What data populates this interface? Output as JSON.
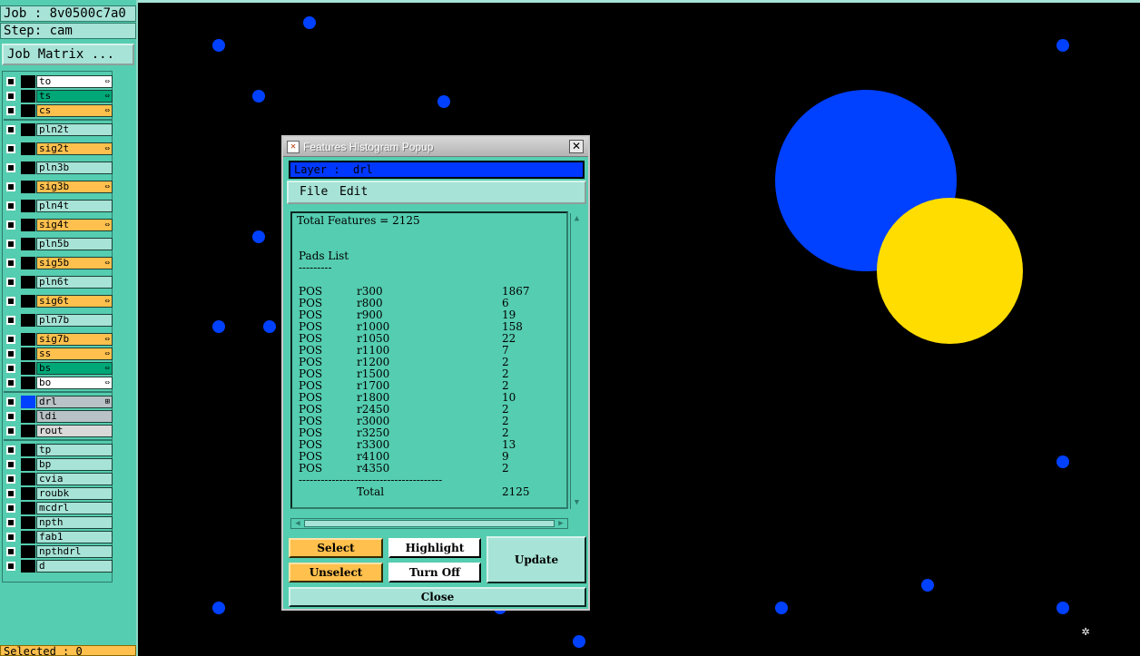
{
  "left_panel": {
    "job": "Job : 8v0500c7a0",
    "step": "Step: cam",
    "job_matrix": "Job Matrix ...",
    "selected": "Selected : 0",
    "layers": [
      {
        "name": "to",
        "color": "#ffffff",
        "flag": "⇔"
      },
      {
        "name": "ts",
        "color": "#00a878",
        "flag": "⇔"
      },
      {
        "name": "cs",
        "color": "#ffc04d",
        "flag": "⇔"
      },
      {
        "name": "pln2t",
        "color": "#a7e3d7",
        "flag": ""
      },
      {
        "name": "sig2t",
        "color": "#ffc04d",
        "flag": "⇔"
      },
      {
        "name": "pln3b",
        "color": "#a7e3d7",
        "flag": ""
      },
      {
        "name": "sig3b",
        "color": "#ffc04d",
        "flag": "⇔"
      },
      {
        "name": "pln4t",
        "color": "#a7e3d7",
        "flag": ""
      },
      {
        "name": "sig4t",
        "color": "#ffc04d",
        "flag": "⇔"
      },
      {
        "name": "pln5b",
        "color": "#a7e3d7",
        "flag": ""
      },
      {
        "name": "sig5b",
        "color": "#ffc04d",
        "flag": "⇔"
      },
      {
        "name": "pln6t",
        "color": "#a7e3d7",
        "flag": ""
      },
      {
        "name": "sig6t",
        "color": "#ffc04d",
        "flag": "⇔"
      },
      {
        "name": "pln7b",
        "color": "#a7e3d7",
        "flag": ""
      },
      {
        "name": "sig7b",
        "color": "#ffc04d",
        "flag": "⇔"
      },
      {
        "name": "ss",
        "color": "#ffc04d",
        "flag": "⇔"
      },
      {
        "name": "bs",
        "color": "#00a878",
        "flag": "⇔"
      },
      {
        "name": "bo",
        "color": "#ffffff",
        "flag": "⇔"
      },
      {
        "name": "drl",
        "color": "#b9c2c6",
        "flag": "⊞"
      },
      {
        "name": "ldi",
        "color": "#b9c2c6",
        "flag": ""
      },
      {
        "name": "rout",
        "color": "#d9d9d9",
        "flag": ""
      },
      {
        "name": "tp",
        "color": "#a7e3d7",
        "flag": ""
      },
      {
        "name": "bp",
        "color": "#a7e3d7",
        "flag": ""
      },
      {
        "name": "cvia",
        "color": "#a7e3d7",
        "flag": ""
      },
      {
        "name": "roubk",
        "color": "#a7e3d7",
        "flag": ""
      },
      {
        "name": "mcdrl",
        "color": "#a7e3d7",
        "flag": ""
      },
      {
        "name": "npth",
        "color": "#a7e3d7",
        "flag": ""
      },
      {
        "name": "fab1",
        "color": "#a7e3d7",
        "flag": ""
      },
      {
        "name": "npthdrl",
        "color": "#a7e3d7",
        "flag": ""
      },
      {
        "name": "d",
        "color": "#a7e3d7",
        "flag": ""
      }
    ]
  },
  "popup": {
    "title": "Features Histogram Popup",
    "layer_label": "Layer :  drl",
    "menu": {
      "file": "File",
      "edit": "Edit"
    },
    "report": {
      "total_features": "Total Features = 2125",
      "section": "Pads List",
      "section_underline": "---------",
      "rows": [
        {
          "type": "POS",
          "symbol": "r300",
          "count": "1867"
        },
        {
          "type": "POS",
          "symbol": "r800",
          "count": "6"
        },
        {
          "type": "POS",
          "symbol": "r900",
          "count": "19"
        },
        {
          "type": "POS",
          "symbol": "r1000",
          "count": "158"
        },
        {
          "type": "POS",
          "symbol": "r1050",
          "count": "22"
        },
        {
          "type": "POS",
          "symbol": "r1100",
          "count": "7"
        },
        {
          "type": "POS",
          "symbol": "r1200",
          "count": "2"
        },
        {
          "type": "POS",
          "symbol": "r1500",
          "count": "2"
        },
        {
          "type": "POS",
          "symbol": "r1700",
          "count": "2"
        },
        {
          "type": "POS",
          "symbol": "r1800",
          "count": "10"
        },
        {
          "type": "POS",
          "symbol": "r2450",
          "count": "2"
        },
        {
          "type": "POS",
          "symbol": "r3000",
          "count": "2"
        },
        {
          "type": "POS",
          "symbol": "r3250",
          "count": "2"
        },
        {
          "type": "POS",
          "symbol": "r3300",
          "count": "13"
        },
        {
          "type": "POS",
          "symbol": "r4100",
          "count": "9"
        },
        {
          "type": "POS",
          "symbol": "r4350",
          "count": "2"
        }
      ],
      "divider": "---------------------------------------",
      "total_label": "Total",
      "total_value": "2125"
    },
    "buttons": {
      "select": "Select",
      "unselect": "Unselect",
      "highlight": "Highlight",
      "turn_off": "Turn Off",
      "update": "Update",
      "close": "Close"
    }
  },
  "colors": {
    "panel": "#55cdb0",
    "pad_blue": "#0040ff",
    "pad_yellow": "#ffdd00",
    "canvas": "#000000"
  }
}
